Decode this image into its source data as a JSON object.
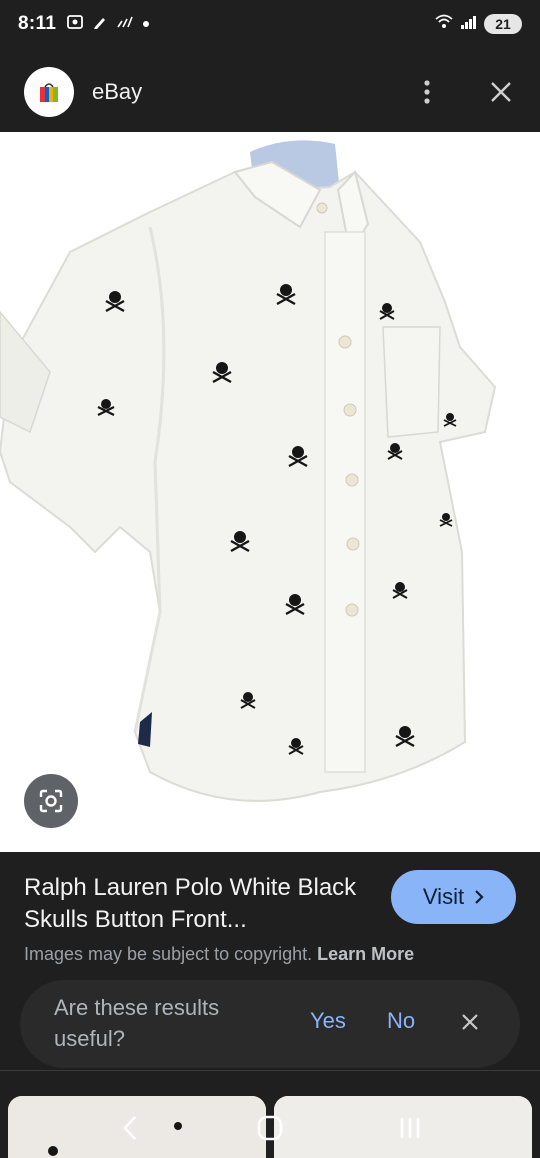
{
  "status_bar": {
    "time": "8:11",
    "battery": "21",
    "icons": [
      "screenshot-icon",
      "pen-icon",
      "signal-no-icon",
      "dot-icon",
      "wifi-icon",
      "cell-signal-icon",
      "battery-icon"
    ]
  },
  "header": {
    "site_name": "eBay",
    "actions": [
      "more-options-icon",
      "close-icon"
    ]
  },
  "image": {
    "subject": "white short-sleeve button-down shirt with black skull pattern",
    "lens_icon": "google-lens-icon"
  },
  "product": {
    "title": "Ralph Lauren Polo White Black Skulls Button Front...",
    "visit_label": "Visit",
    "visit_icon": "chevron-right-icon",
    "copyright_text": "Images may be subject to copyright.",
    "learn_more": "Learn More"
  },
  "feedback": {
    "question": "Are these results useful?",
    "yes": "Yes",
    "no": "No"
  },
  "nav": [
    "back-icon",
    "home-icon",
    "recents-icon"
  ],
  "colors": {
    "background": "#1f1f1f",
    "accent": "#8ab4f8",
    "muted_text": "#9aa0a6"
  }
}
